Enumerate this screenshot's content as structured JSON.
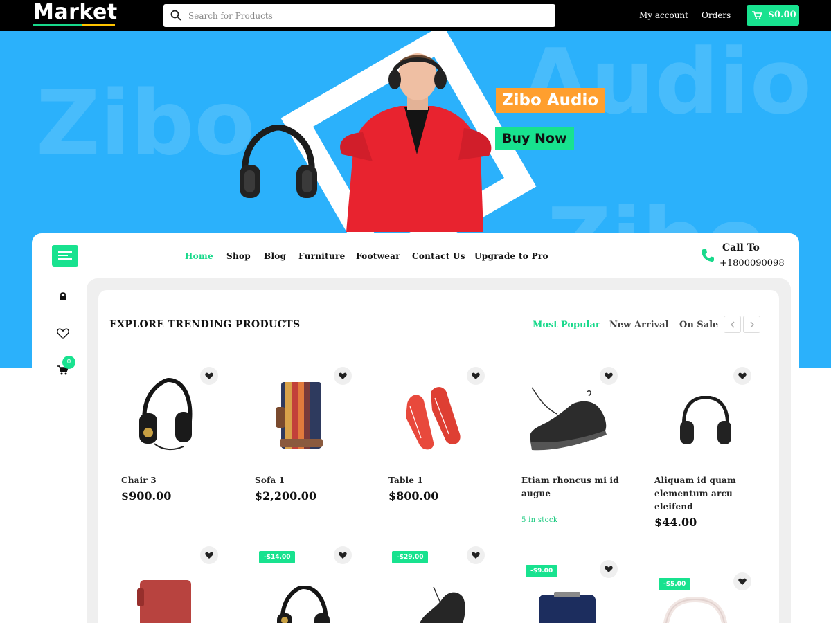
{
  "header": {
    "logo": "Market",
    "search_placeholder": "Search for Products",
    "links": [
      "My account",
      "Orders"
    ],
    "cart_total": "$0.00"
  },
  "hero": {
    "bg_words": [
      "Zibo",
      "Audio",
      "Zibo"
    ],
    "label": "Zibo Audio",
    "cta": "Buy Now"
  },
  "nav": {
    "items": [
      "Home",
      "Shop",
      "Blog",
      "Furniture",
      "Footwear",
      "Contact Us",
      "Upgrade to Pro"
    ],
    "active": "Home",
    "call_title": "Call To",
    "call_number": "+1800090098"
  },
  "sidebar": {
    "cart_count": "0"
  },
  "section": {
    "title": "EXPLORE TRENDING PRODUCTS",
    "filters": [
      "Most Popular",
      "New Arrival",
      "On Sale"
    ],
    "active_filter": "Most Popular"
  },
  "products": [
    {
      "name": "Chair 3",
      "price": "$900.00",
      "icon": "headphones-gold"
    },
    {
      "name": "Sofa 1",
      "price": "$2,200.00",
      "icon": "striped-wallet"
    },
    {
      "name": "Table 1",
      "price": "$800.00",
      "icon": "red-shoes"
    },
    {
      "name_lines": [
        "Etiam rhoncus mi id",
        "augue"
      ],
      "stock": "5 in stock",
      "icon": "black-sneaker"
    },
    {
      "name_lines": [
        "Aliquam id quam",
        "elementum arcu",
        "eleifend"
      ],
      "price": "$44.00",
      "icon": "black-headphones"
    }
  ],
  "second_row": [
    {
      "icon": "red-wallet"
    },
    {
      "sale": "-$14.00",
      "icon": "headphones-gold"
    },
    {
      "sale": "-$29.00",
      "icon": "black-sneaker"
    },
    {
      "sale": "-$9.00",
      "icon": "blue-watch"
    },
    {
      "sale": "-$5.00",
      "icon": "white-headphones"
    }
  ],
  "colors": {
    "accent": "#18e28f",
    "hero_bg": "#2bb1fb",
    "label_orange": "#ff9f2e"
  }
}
